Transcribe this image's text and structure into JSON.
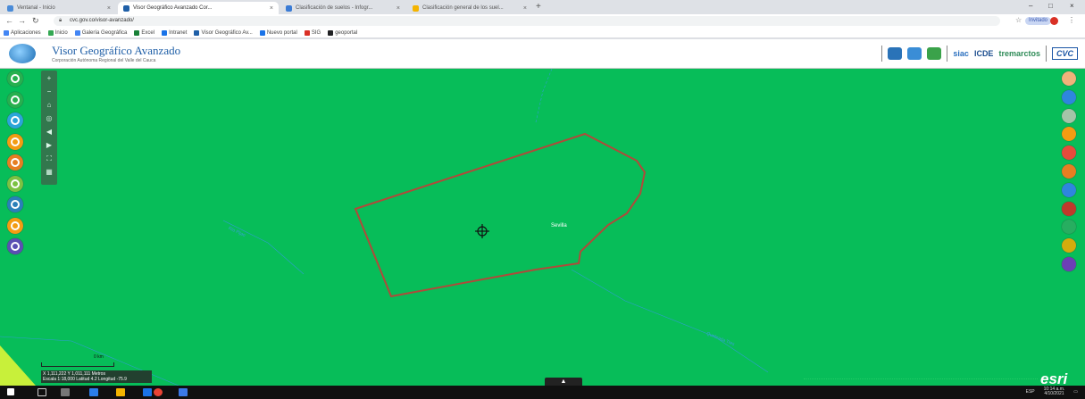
{
  "browser": {
    "tabs": [
      {
        "label": "Ventanal - Inicio",
        "active": false,
        "favicon_color": "#4a8bd8"
      },
      {
        "label": "Visor Geográfico Avanzado Cor...",
        "active": true,
        "favicon_color": "#1f5fa7"
      },
      {
        "label": "Clasificación de suelos - Infogr...",
        "active": false,
        "favicon_color": "#3a7bd5"
      },
      {
        "label": "Clasificación general de los suel...",
        "active": false,
        "favicon_color": "#f4b400"
      }
    ],
    "new_tab_icon": "plus-icon",
    "url": "cvc.gov.co/visor-avanzado/",
    "profile_label": "Invitado"
  },
  "bookmarks": [
    {
      "label": "Aplicaciones",
      "color": "#4285f4"
    },
    {
      "label": "Inicio",
      "color": "#34a853"
    },
    {
      "label": "Galería Geográfica",
      "color": "#4285f4"
    },
    {
      "label": "Excel",
      "color": "#188038"
    },
    {
      "label": "Intranet",
      "color": "#1a73e8"
    },
    {
      "label": "Visor Geográfico Av...",
      "color": "#1f5fa7"
    },
    {
      "label": "Nuevo portal",
      "color": "#1a73e8"
    },
    {
      "label": "SIG",
      "color": "#d93025"
    },
    {
      "label": "geoportal",
      "color": "#202124"
    }
  ],
  "app": {
    "title": "Visor Geográfico Avanzado",
    "subtitle": "Corporación Autónoma Regional del Valle del Cauca",
    "header_icons": [
      {
        "name": "mountain-icon",
        "color": "#2a73b8"
      },
      {
        "name": "layers-icon",
        "color": "#3a8dd6"
      },
      {
        "name": "globe-icon",
        "color": "#3aa24a"
      }
    ],
    "brands": [
      {
        "label": "siac",
        "color": "#2a6fbf"
      },
      {
        "label": "ICDE",
        "color": "#1d4f8f"
      },
      {
        "label": "tremarctos",
        "color": "#2e8b57"
      },
      {
        "label": "CVC",
        "color": "#1b56a5"
      }
    ]
  },
  "map": {
    "background": "#07bd59",
    "polygon_label": "Sevilla",
    "river_labels": [
      "Río Pijao",
      "Quebrada Tres"
    ],
    "scale_label": "0 km",
    "coords": "X 1,111,222 Y 1,011,111 Metros",
    "coords_line2": "Escala 1:18,000 Latitud 4.2 Longitud -75.9",
    "esri_label": "esri",
    "collapse_label": "▲"
  },
  "left_tools": [
    {
      "name": "help-icon",
      "color": "#27b04f"
    },
    {
      "name": "add-icon",
      "color": "#27b04f"
    },
    {
      "name": "basemap-icon",
      "color": "#2ba5d9"
    },
    {
      "name": "search-icon",
      "color": "#f39c12"
    },
    {
      "name": "print-icon",
      "color": "#e67e22"
    },
    {
      "name": "zoom-icon",
      "color": "#7cc242"
    },
    {
      "name": "measure-icon",
      "color": "#2980b9"
    },
    {
      "name": "draw-icon",
      "color": "#f39c12"
    },
    {
      "name": "list-icon",
      "color": "#5b4fb3"
    }
  ],
  "nav_panel": {
    "icons": [
      "+",
      "−",
      "⌂",
      "◎",
      "◀",
      "▶",
      "⛶",
      "▦"
    ]
  },
  "right_tools": [
    {
      "name": "info-icon",
      "color": "#f0b27a"
    },
    {
      "name": "water-icon",
      "color": "#2e86de"
    },
    {
      "name": "soil-icon",
      "color": "#a5c4a8"
    },
    {
      "name": "sun-icon",
      "color": "#f39c12"
    },
    {
      "name": "fish-icon",
      "color": "#e74c3c"
    },
    {
      "name": "people-icon",
      "color": "#e67e22"
    },
    {
      "name": "chart-icon",
      "color": "#2e86de"
    },
    {
      "name": "mountain-icon",
      "color": "#c0392b"
    },
    {
      "name": "grid-icon",
      "color": "#27ae60"
    },
    {
      "name": "face-icon",
      "color": "#d4ac0d"
    },
    {
      "name": "tools-icon",
      "color": "#6c3fb5"
    }
  ],
  "taskbar": {
    "time": "10:14 a.m.",
    "date": "4/10/2021",
    "tray": "ESP"
  }
}
